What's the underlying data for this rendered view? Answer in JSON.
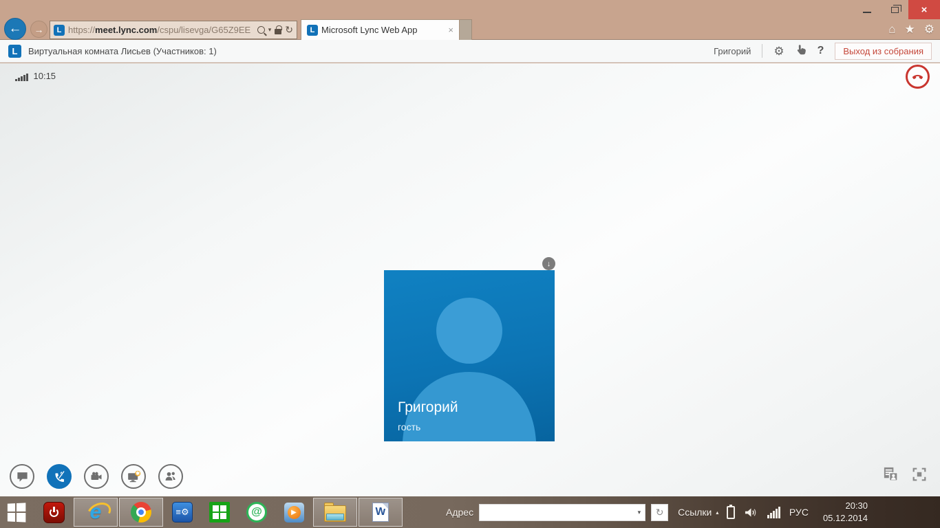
{
  "browser": {
    "url": {
      "scheme": "https://",
      "domain": "meet.lync.com",
      "path": "/cspu/lisevga/G65Z9EE"
    },
    "tab": {
      "title": "Microsoft Lync Web App"
    }
  },
  "lync": {
    "room_title": "Виртуальная комната Лисьев (Участников: 1)",
    "user_name": "Григорий",
    "exit_button": "Выход из собрания",
    "call_duration": "10:15"
  },
  "participant": {
    "name": "Григорий",
    "role": "гость"
  },
  "taskbar": {
    "address_label": "Адрес",
    "address_value": "",
    "links_label": "Ссылки",
    "language": "РУС",
    "time": "20:30",
    "date": "05.12.2014"
  },
  "icons": {
    "close": "×",
    "back": "←",
    "forward": "→",
    "home": "⌂",
    "favorites": "★",
    "settings": "⚙",
    "lync_logo": "L",
    "help": "?",
    "caret_down": "▾",
    "caret_up": "▴",
    "refresh": "↻",
    "download_arrow": "↓",
    "play": "▶",
    "at": "@",
    "ie": "e",
    "word": "W",
    "sys_lines": "≡⚙"
  },
  "colors": {
    "chrome_tan": "#c8a48e",
    "close_red": "#d04a42",
    "lync_blue": "#1272b8",
    "tile_blue_top": "#1081c2",
    "tile_blue_bottom": "#07649f",
    "silhouette": "#3b9dd6",
    "active_toolbar_blue": "#1172b9",
    "hangup_red": "#c9362f",
    "exit_text_red": "#c5473a"
  }
}
